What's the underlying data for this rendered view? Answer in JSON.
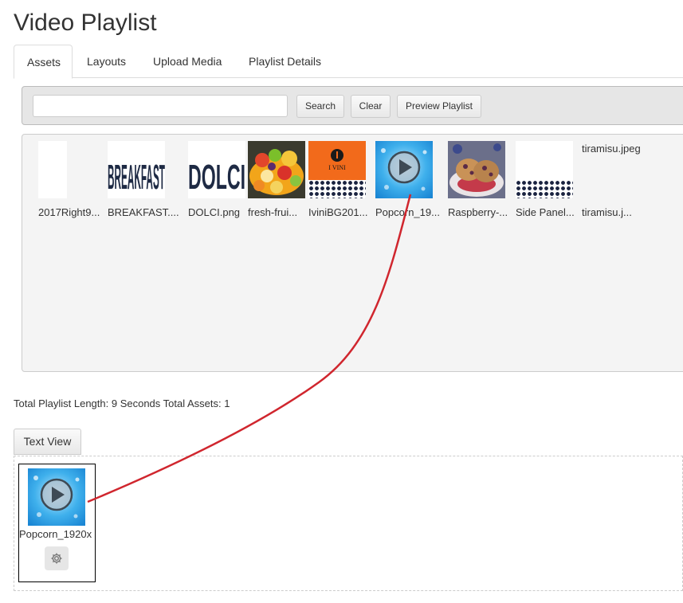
{
  "page": {
    "title": "Video Playlist"
  },
  "tabs": [
    {
      "label": "Assets",
      "active": true
    },
    {
      "label": "Layouts",
      "active": false
    },
    {
      "label": "Upload Media",
      "active": false
    },
    {
      "label": "Playlist Details",
      "active": false
    }
  ],
  "search": {
    "value": "",
    "placeholder": "",
    "search_label": "Search",
    "clear_label": "Clear",
    "preview_label": "Preview Playlist"
  },
  "assets": [
    {
      "label": "2017Right9...",
      "thumb": "blank-image-thumb"
    },
    {
      "label": "BREAKFAST....",
      "thumb": "breakfast-text-image-thumb",
      "thumb_text": "BREAKFAST"
    },
    {
      "label": "DOLCI.png",
      "thumb": "dolci-text-image-thumb",
      "thumb_text": "DOLCI"
    },
    {
      "label": "fresh-frui...",
      "thumb": "fruit-bowl-image-thumb"
    },
    {
      "label": "IviniBG201...",
      "thumb": "ivini-logo-image-thumb",
      "thumb_text": "I VINI"
    },
    {
      "label": "Popcorn_19...",
      "thumb": "video-play-thumb"
    },
    {
      "label": "Raspberry-...",
      "thumb": "raspberry-scone-image-thumb"
    },
    {
      "label": "Side Panel...",
      "thumb": "side-panel-image-thumb"
    },
    {
      "label": "tiramisu.j...",
      "thumb": "missing-image",
      "title_text": "tiramisu.jpeg"
    }
  ],
  "summary": {
    "text": "Total Playlist Length: 9 Seconds Total Assets: 1"
  },
  "text_view": {
    "label": "Text View"
  },
  "playlist": [
    {
      "label": "Popcorn_1920x",
      "thumb": "video-play-thumb",
      "settings_icon": "gear-icon"
    }
  ],
  "colors": {
    "connector_line": "#d0262e",
    "dark_navy": "#1e2a44",
    "ivini_orange": "#f26a1b",
    "video_blue": "#2b9fe0"
  }
}
